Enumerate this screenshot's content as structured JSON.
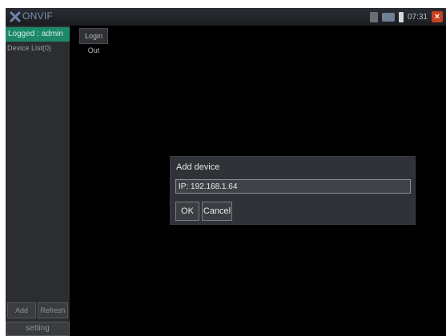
{
  "app": {
    "title": "ONVIF",
    "icon": "onvif-logo-icon"
  },
  "status_bar": {
    "time": "07:31",
    "icons": [
      "sd-card-icon",
      "network-icon",
      "battery-icon",
      "close-icon"
    ],
    "close_color": "#c8411f"
  },
  "sidebar": {
    "logged_label": "Logged : admin",
    "device_list_label": "Device List(0)",
    "add_label": "Add",
    "refresh_label": "Refresh",
    "setting_label": "setting",
    "accent": "#1c8a6a"
  },
  "main": {
    "login_out_label": "Login Out"
  },
  "dialog": {
    "title": "Add device",
    "input_value": "IP: 192.168.1.64",
    "ok_label": "OK",
    "cancel_label": "Cancel"
  }
}
